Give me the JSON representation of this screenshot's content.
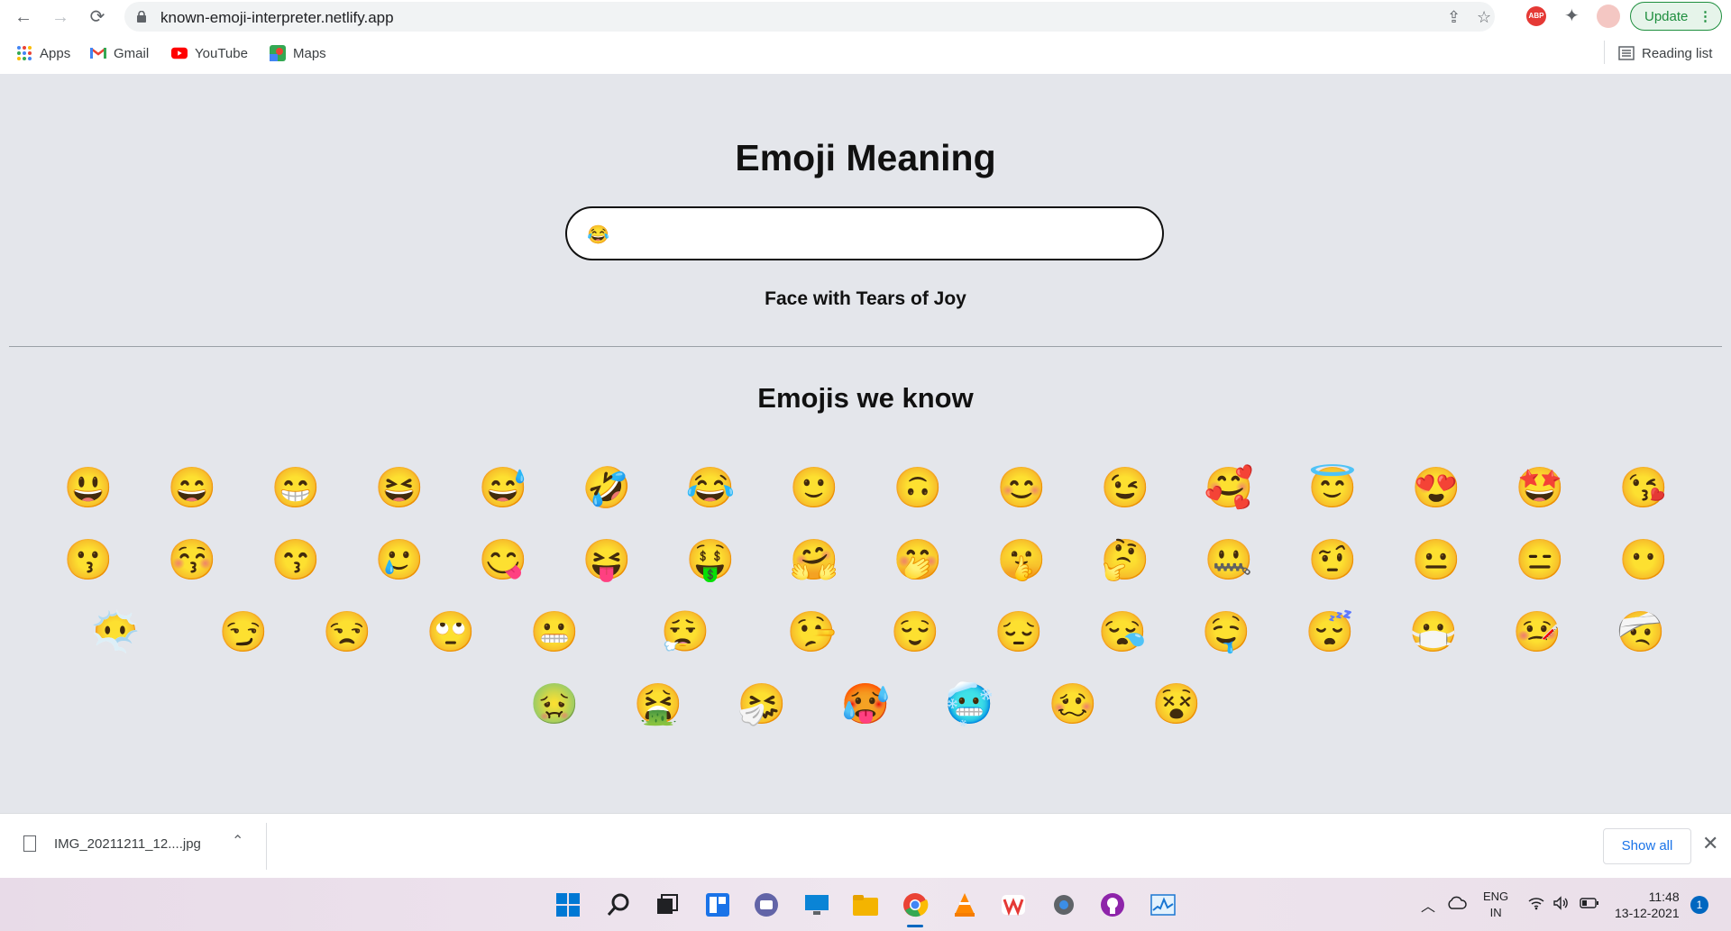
{
  "browser": {
    "url": "known-emoji-interpreter.netlify.app",
    "update_label": "Update",
    "bookmarks": [
      {
        "label": "Apps",
        "icon": "apps-grid-icon"
      },
      {
        "label": "Gmail",
        "icon": "gmail-icon"
      },
      {
        "label": "YouTube",
        "icon": "youtube-icon"
      },
      {
        "label": "Maps",
        "icon": "maps-icon"
      }
    ],
    "reading_list": "Reading list",
    "extension_abp": "ABP"
  },
  "page": {
    "title": "Emoji Meaning",
    "input_value": "😂",
    "meaning": "Face with Tears of Joy",
    "section_title": "Emojis we know",
    "emoji_rows": [
      [
        "😃",
        "😄",
        "😁",
        "😆",
        "😅",
        "🤣",
        "😂",
        "🙂",
        "🙃",
        "😊",
        "😉",
        "🥰",
        "😇",
        "😍",
        "🤩",
        "😘"
      ],
      [
        "😗",
        "😚",
        "😙",
        "🥲",
        "😋",
        "😝",
        "🤑",
        "🤗",
        "🤭",
        "🤫",
        "🤔",
        "🤐",
        "🤨",
        "😐",
        "😑",
        "😶"
      ],
      [
        "😶‍🌫️",
        "😏",
        "😒",
        "🙄",
        "😬",
        "😮‍💨",
        "🤥",
        "😌",
        "😔",
        "😪",
        "🤤",
        "😴",
        "😷",
        "🤒",
        "🤕"
      ],
      [
        "🤢",
        "🤮",
        "🤧",
        "🥵",
        "🥶",
        "🥴",
        "😵"
      ]
    ]
  },
  "downloads": {
    "file_name": "IMG_20211211_12....jpg",
    "show_all": "Show all"
  },
  "taskbar": {
    "lang_top": "ENG",
    "lang_bottom": "IN",
    "time": "11:48",
    "date": "13-12-2021",
    "notification_count": "1"
  }
}
